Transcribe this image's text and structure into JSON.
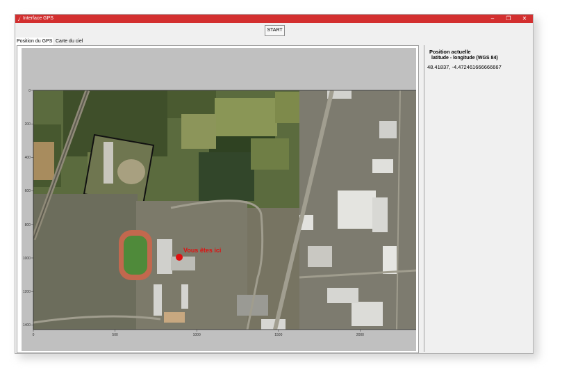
{
  "window": {
    "title": "Interface GPS",
    "controls": [
      "minimize-icon",
      "restore-icon",
      "close-icon"
    ],
    "title_color": "#d32f2f"
  },
  "toolbar": {
    "start_label": "START"
  },
  "tabs": [
    {
      "label": "Position du GPS",
      "selected": true
    },
    {
      "label": "Carte du ciel",
      "selected": false
    }
  ],
  "map": {
    "marker_label": "Vous êtes ici",
    "marker_color": "#e01010",
    "y_ticks": [
      "0",
      "200",
      "400",
      "600",
      "800",
      "1000",
      "1200",
      "1400"
    ],
    "x_ticks": [
      "0",
      "500",
      "1000",
      "1500",
      "2000"
    ]
  },
  "position": {
    "title": "Position actuelle",
    "subtitle": "latitude - longitude (WGS 84)",
    "value": "48.41837, -4.472461666666667"
  }
}
